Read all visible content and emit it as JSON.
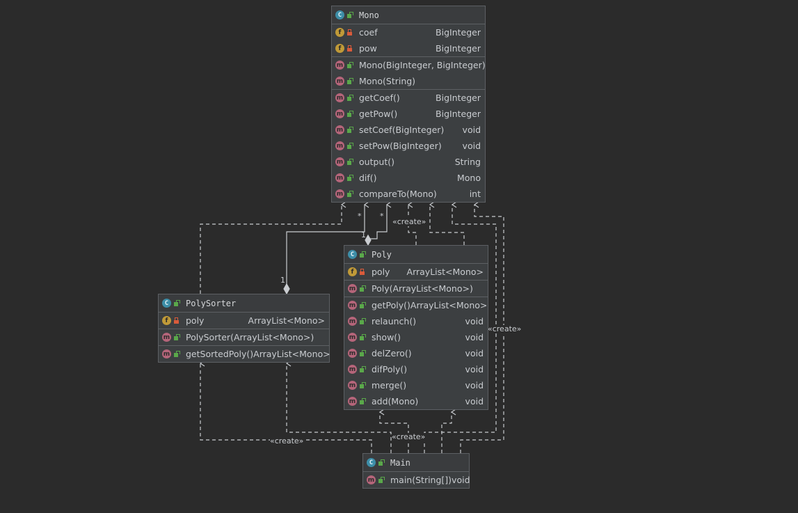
{
  "classes": {
    "mono": {
      "name": "Mono",
      "fields": [
        {
          "name": "coef",
          "type": "BigInteger",
          "visibility": "private"
        },
        {
          "name": "pow",
          "type": "BigInteger",
          "visibility": "private"
        }
      ],
      "constructors": [
        {
          "name": "Mono(BigInteger, BigInteger)",
          "type": ""
        },
        {
          "name": "Mono(String)",
          "type": ""
        }
      ],
      "methods": [
        {
          "name": "getCoef()",
          "type": "BigInteger"
        },
        {
          "name": "getPow()",
          "type": "BigInteger"
        },
        {
          "name": "setCoef(BigInteger)",
          "type": "void"
        },
        {
          "name": "setPow(BigInteger)",
          "type": "void"
        },
        {
          "name": "output()",
          "type": "String"
        },
        {
          "name": "dif()",
          "type": "Mono"
        },
        {
          "name": "compareTo(Mono)",
          "type": "int"
        }
      ]
    },
    "poly": {
      "name": "Poly",
      "fields": [
        {
          "name": "poly",
          "type": "ArrayList<Mono>",
          "visibility": "private"
        }
      ],
      "constructors": [
        {
          "name": "Poly(ArrayList<Mono>)",
          "type": ""
        }
      ],
      "methods": [
        {
          "name": "getPoly()",
          "type": "ArrayList<Mono>"
        },
        {
          "name": "relaunch()",
          "type": "void"
        },
        {
          "name": "show()",
          "type": "void"
        },
        {
          "name": "delZero()",
          "type": "void"
        },
        {
          "name": "difPoly()",
          "type": "void"
        },
        {
          "name": "merge()",
          "type": "void"
        },
        {
          "name": "add(Mono)",
          "type": "void"
        }
      ]
    },
    "polysorter": {
      "name": "PolySorter",
      "fields": [
        {
          "name": "poly",
          "type": "ArrayList<Mono>",
          "visibility": "private"
        }
      ],
      "constructors": [
        {
          "name": "PolySorter(ArrayList<Mono>)",
          "type": ""
        }
      ],
      "methods": [
        {
          "name": "getSortedPoly()",
          "type": "ArrayList<Mono>"
        }
      ]
    },
    "main": {
      "name": "Main",
      "fields": [],
      "constructors": [],
      "methods": [
        {
          "name": "main(String[])",
          "type": "void"
        }
      ]
    }
  },
  "labels": {
    "create": "«create»",
    "mult_star": "*",
    "mult_one": "1"
  },
  "icons": {
    "class": "C",
    "field": "f",
    "method": "m"
  }
}
